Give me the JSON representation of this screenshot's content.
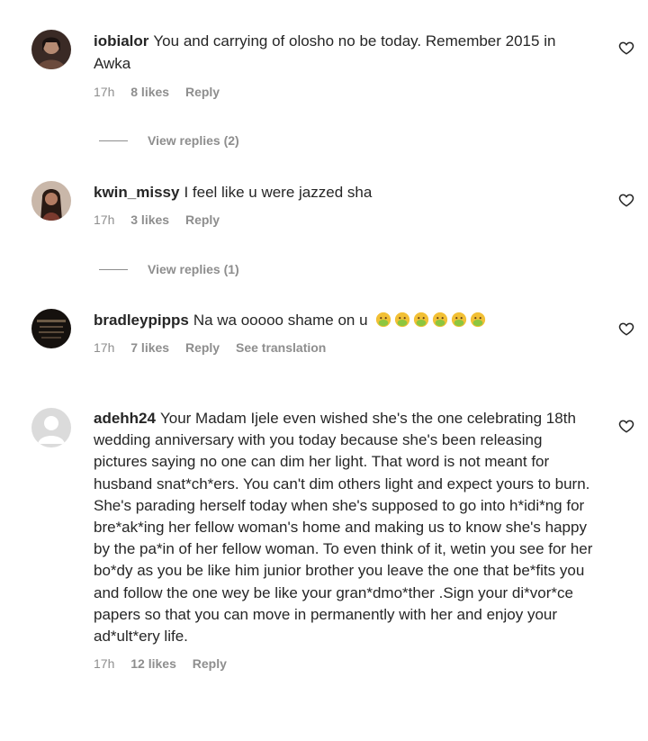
{
  "comments": [
    {
      "username": "iobialor",
      "text": "You and carrying of olosho no be today. Remember 2015 in Awka",
      "time": "17h",
      "likes": "8 likes",
      "reply": "Reply",
      "view_replies": "View replies (2)"
    },
    {
      "username": "kwin_missy",
      "text": "I feel like u were jazzed sha",
      "time": "17h",
      "likes": "3 likes",
      "reply": "Reply",
      "view_replies": "View replies (1)"
    },
    {
      "username": "bradleypipps",
      "text": "Na wa ooooo shame on u",
      "emoji": "sick-face-emoji",
      "time": "17h",
      "likes": "7 likes",
      "reply": "Reply",
      "translation": "See translation"
    },
    {
      "username": "adehh24",
      "text": "Your Madam Ijele even wished she's the one celebrating 18th wedding anniversary with you today because she's been releasing pictures saying no one can dim her light. That word is not meant for husband snat*ch*ers. You can't dim others light and expect yours to burn. She's parading herself today when she's supposed to go into h*idi*ng for bre*ak*ing her fellow woman's home and making us to know she's happy by the pa*in of her fellow woman. To even think of it, wetin you see for her bo*dy as you be like him junior brother you leave the one that be*fits you and follow the one wey be like your gran*dmo*ther .Sign your di*vor*ce papers so that you can move in permanently with her and enjoy your ad*ult*ery life.",
      "time": "17h",
      "likes": "12 likes",
      "reply": "Reply"
    }
  ]
}
